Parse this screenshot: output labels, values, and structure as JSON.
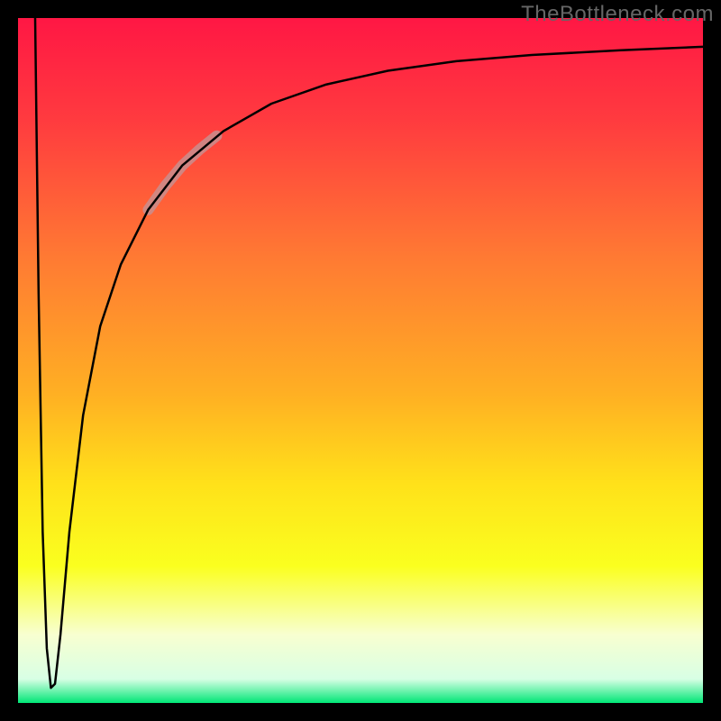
{
  "watermark": "TheBottleneck.com",
  "chart_data": {
    "type": "line",
    "title": "",
    "xlabel": "",
    "ylabel": "",
    "xlim": [
      0,
      100
    ],
    "ylim": [
      0,
      100
    ],
    "gradient_stops": [
      {
        "offset": 0.0,
        "color": "#ff1744"
      },
      {
        "offset": 0.15,
        "color": "#ff3b3f"
      },
      {
        "offset": 0.35,
        "color": "#ff7a33"
      },
      {
        "offset": 0.55,
        "color": "#ffb023"
      },
      {
        "offset": 0.68,
        "color": "#ffe11a"
      },
      {
        "offset": 0.8,
        "color": "#faff1f"
      },
      {
        "offset": 0.9,
        "color": "#f8ffd0"
      },
      {
        "offset": 0.965,
        "color": "#d8ffe5"
      },
      {
        "offset": 1.0,
        "color": "#00e676"
      }
    ],
    "series": [
      {
        "name": "bottleneck-curve",
        "color": "#000000",
        "stroke_width": 2.5,
        "points": [
          {
            "x": 2.5,
            "y": 100
          },
          {
            "x": 3.0,
            "y": 60
          },
          {
            "x": 3.6,
            "y": 25
          },
          {
            "x": 4.2,
            "y": 8
          },
          {
            "x": 4.8,
            "y": 2.2
          },
          {
            "x": 5.4,
            "y": 2.8
          },
          {
            "x": 6.2,
            "y": 10
          },
          {
            "x": 7.5,
            "y": 25
          },
          {
            "x": 9.5,
            "y": 42
          },
          {
            "x": 12.0,
            "y": 55
          },
          {
            "x": 15.0,
            "y": 64
          },
          {
            "x": 19.0,
            "y": 72
          },
          {
            "x": 24.0,
            "y": 78.5
          },
          {
            "x": 30.0,
            "y": 83.5
          },
          {
            "x": 37.0,
            "y": 87.5
          },
          {
            "x": 45.0,
            "y": 90.3
          },
          {
            "x": 54.0,
            "y": 92.3
          },
          {
            "x": 64.0,
            "y": 93.7
          },
          {
            "x": 75.0,
            "y": 94.6
          },
          {
            "x": 88.0,
            "y": 95.3
          },
          {
            "x": 100.0,
            "y": 95.8
          }
        ]
      },
      {
        "name": "highlight-segment",
        "color": "#c98e8e",
        "stroke_width": 12,
        "opacity": 0.85,
        "points": [
          {
            "x": 19.0,
            "y": 72.0
          },
          {
            "x": 21.5,
            "y": 75.5
          },
          {
            "x": 24.0,
            "y": 78.5
          },
          {
            "x": 26.5,
            "y": 80.8
          },
          {
            "x": 29.0,
            "y": 82.8
          }
        ]
      }
    ],
    "frame": {
      "stroke": "#000000",
      "stroke_width": 20
    }
  }
}
